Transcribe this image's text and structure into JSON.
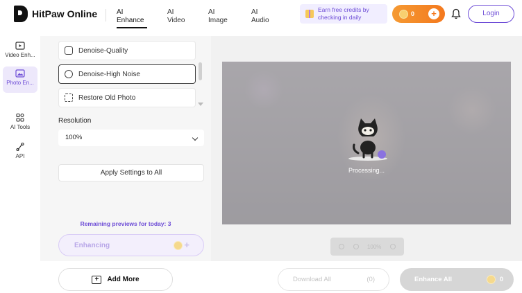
{
  "app": {
    "name": "HitPaw Online"
  },
  "nav": {
    "tabs": [
      {
        "line1": "AI",
        "line2": "Enhance",
        "active": true
      },
      {
        "line1": "AI",
        "line2": "Video",
        "active": false
      },
      {
        "line1": "AI",
        "line2": "Image",
        "active": false
      },
      {
        "line1": "AI",
        "line2": "Audio",
        "active": false
      }
    ]
  },
  "header": {
    "credit_banner_line1": "Earn free credits by",
    "credit_banner_line2": "checking in daily",
    "coin_count": "0",
    "coin_plus": "+",
    "login_label": "Login"
  },
  "rail": {
    "items": [
      {
        "label": "Video Enh...",
        "icon": "video-enhance-icon",
        "active": false
      },
      {
        "label": "Photo En...",
        "icon": "photo-enhance-icon",
        "active": true
      },
      {
        "label": "AI Tools",
        "icon": "ai-tools-icon",
        "active": false
      },
      {
        "label": "API",
        "icon": "api-icon",
        "active": false
      }
    ]
  },
  "panel": {
    "options": [
      {
        "label": "Denoise-Quality",
        "icon": "denoise-quality-icon",
        "selected": false
      },
      {
        "label": "Denoise-High Noise",
        "icon": "denoise-high-noise-icon",
        "selected": true
      },
      {
        "label": "Restore Old Photo",
        "icon": "restore-photo-icon",
        "selected": false
      }
    ],
    "resolution_label": "Resolution",
    "resolution_value": "100%",
    "apply_label": "Apply Settings to All",
    "remaining_text": "Remaining previews for today: 3",
    "enhancing_label": "Enhancing",
    "enhancing_plus": "+"
  },
  "preview": {
    "processing_text": "Processing...",
    "zoom_value": "100%"
  },
  "bottom": {
    "add_more_label": "Add More",
    "add_more_icon_glyph": "+",
    "download_all_label": "Download All",
    "download_all_count": "(0)",
    "enhance_all_label": "Enhance All",
    "enhance_all_count": "0"
  },
  "colors": {
    "accent": "#6c4bd6",
    "coin_orange": "#f4791e",
    "banner_bg": "#f1eeff"
  }
}
